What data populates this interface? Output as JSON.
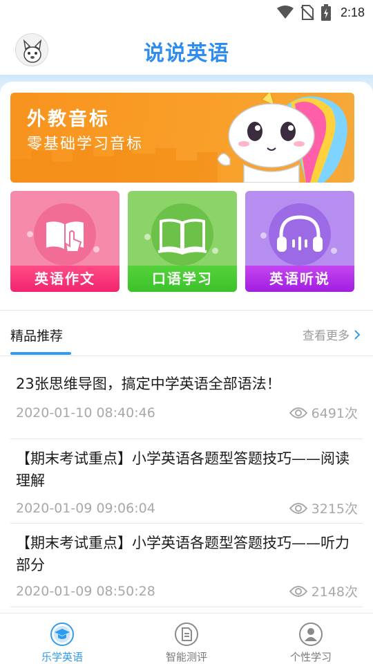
{
  "status_bar": {
    "time": "2:18",
    "icons": [
      "wifi-icon",
      "no-sim-icon",
      "battery-charging-icon"
    ]
  },
  "header": {
    "title": "说说英语",
    "avatar_icon": "squirrel-avatar-icon"
  },
  "banner": {
    "title": "外教音标",
    "subtitle": "零基础学习音标",
    "illustration": "unicorn-icon",
    "color": "#f7931e"
  },
  "features": [
    {
      "label": "英语作文",
      "icon": "book-pointer-icon",
      "color": "#f58aaa"
    },
    {
      "label": "口语学习",
      "icon": "open-book-icon",
      "color": "#8cd36a"
    },
    {
      "label": "英语听说",
      "icon": "headphones-icon",
      "color": "#b68ef0"
    }
  ],
  "recommend": {
    "title": "精品推荐",
    "more_label": "查看更多",
    "accent": "#2f9cf0"
  },
  "articles": [
    {
      "title": "23张思维导图，搞定中学英语全部语法！",
      "date": "2020-01-10 08:40:46",
      "views": "6491次"
    },
    {
      "title": "【期末考试重点】小学英语各题型答题技巧——阅读理解",
      "date": "2020-01-09 09:06:04",
      "views": "3215次"
    },
    {
      "title": "【期末考试重点】小学英语各题型答题技巧——听力部分",
      "date": "2020-01-09 08:50:28",
      "views": "2148次"
    }
  ],
  "nav": [
    {
      "label": "乐学英语",
      "icon": "graduation-cap-icon",
      "active": true
    },
    {
      "label": "智能测评",
      "icon": "document-icon",
      "active": false
    },
    {
      "label": "个性学习",
      "icon": "user-icon",
      "active": false
    }
  ]
}
